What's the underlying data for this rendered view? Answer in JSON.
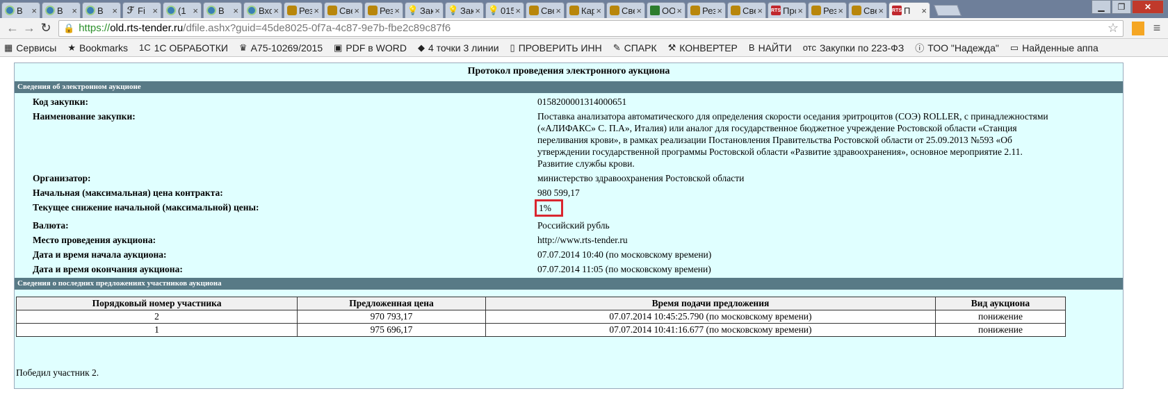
{
  "tabs": [
    {
      "label": "В",
      "icon": "generic"
    },
    {
      "label": "В",
      "icon": "generic"
    },
    {
      "label": "В",
      "icon": "generic"
    },
    {
      "label": "Fi",
      "icon": "f"
    },
    {
      "label": "(1",
      "icon": "generic"
    },
    {
      "label": "В",
      "icon": "generic"
    },
    {
      "label": "Вход",
      "icon": "generic"
    },
    {
      "label": "Резу",
      "icon": "eagle"
    },
    {
      "label": "Све",
      "icon": "eagle"
    },
    {
      "label": "Резу",
      "icon": "eagle"
    },
    {
      "label": "Заку",
      "icon": "bulb"
    },
    {
      "label": "Заку",
      "icon": "bulb"
    },
    {
      "label": "015",
      "icon": "bulb"
    },
    {
      "label": "Све",
      "icon": "eagle"
    },
    {
      "label": "Кар",
      "icon": "eagle"
    },
    {
      "label": "Све",
      "icon": "eagle"
    },
    {
      "label": "ООС",
      "icon": "lock"
    },
    {
      "label": "Резу",
      "icon": "eagle"
    },
    {
      "label": "Све",
      "icon": "eagle"
    },
    {
      "label": "Про",
      "icon": "rts"
    },
    {
      "label": "Резу",
      "icon": "eagle"
    },
    {
      "label": "Све",
      "icon": "eagle"
    },
    {
      "label": "П",
      "icon": "rts",
      "active": true
    }
  ],
  "favicon_texts": {
    "rts": "RTS",
    "f": "ℱ"
  },
  "url": {
    "scheme": "https://",
    "host": "old.rts-tender.ru",
    "path": "/dfile.ashx?guid=45de8025-0f7a-4c87-9e7b-fbe2c89c87f6"
  },
  "bookmarks": [
    {
      "label": "Сервисы",
      "icon": "▦"
    },
    {
      "label": "Bookmarks",
      "icon": "★"
    },
    {
      "label": "1С ОБРАБОТКИ",
      "icon": "1С"
    },
    {
      "label": "А75-10269/2015",
      "icon": "♛"
    },
    {
      "label": "PDF в WORD",
      "icon": "▣"
    },
    {
      "label": "4 точки 3 линии",
      "icon": "◆"
    },
    {
      "label": "ПРОВЕРИТЬ ИНН",
      "icon": "▯"
    },
    {
      "label": "СПАРК",
      "icon": "✎"
    },
    {
      "label": "КОНВЕРТЕР",
      "icon": "⚒"
    },
    {
      "label": "НАЙТИ",
      "icon": "B"
    },
    {
      "label": "Закупки по 223-ФЗ",
      "icon": "отс"
    },
    {
      "label": "ТОО \"Надежда\"",
      "icon": "ⓘ"
    },
    {
      "label": "Найденные аппа",
      "icon": "▭"
    }
  ],
  "doc": {
    "title": "Протокол проведения электронного аукциона",
    "section1": "Сведения об электронном аукционе",
    "fields": [
      {
        "label": "Код закупки:",
        "value": "0158200001314000651"
      },
      {
        "label": "Наименование закупки:",
        "value": "Поставка анализатора автоматического для определения скорости оседания эритроцитов (СОЭ) ROLLER, с принадлежностями («АЛИФАКС» С. П.А», Италия) или аналог для государственное бюджетное учреждение Ростовской области «Станция переливания крови», в рамках реализации Постановления Правительства Ростовской области от 25.09.2013 №593 «Об утверждении государственной программы Ростовской области «Развитие здравоохранения», основное мероприятие 2.11. Развитие службы крови."
      },
      {
        "label": "Организатор:",
        "value": "министерство здравоохранения Ростовской области"
      },
      {
        "label": "Начальная (максимальная) цена контракта:",
        "value": "980 599,17"
      },
      {
        "label": "Текущее снижение начальной (максимальной) цены:",
        "value": "1%",
        "highlight": true
      },
      {
        "label": "Валюта:",
        "value": "Российский рубль"
      },
      {
        "label": "Место проведения аукциона:",
        "value": "http://www.rts-tender.ru"
      },
      {
        "label": "Дата и время начала аукциона:",
        "value": "07.07.2014 10:40 (по московскому времени)"
      },
      {
        "label": "Дата и время окончания аукциона:",
        "value": "07.07.2014 11:05 (по московскому времени)"
      }
    ],
    "section2": "Сведения о последних предложениях участников аукциона",
    "table": {
      "headers": [
        "Порядковый номер участника",
        "Предложенная цена",
        "Время подачи предложения",
        "Вид аукциона"
      ],
      "rows": [
        [
          "2",
          "970 793,17",
          "07.07.2014 10:45:25.790 (по московскому времени)",
          "понижение"
        ],
        [
          "1",
          "975 696,17",
          "07.07.2014 10:41:16.677 (по московскому времени)",
          "понижение"
        ]
      ]
    },
    "winner": "Победил участник 2."
  }
}
